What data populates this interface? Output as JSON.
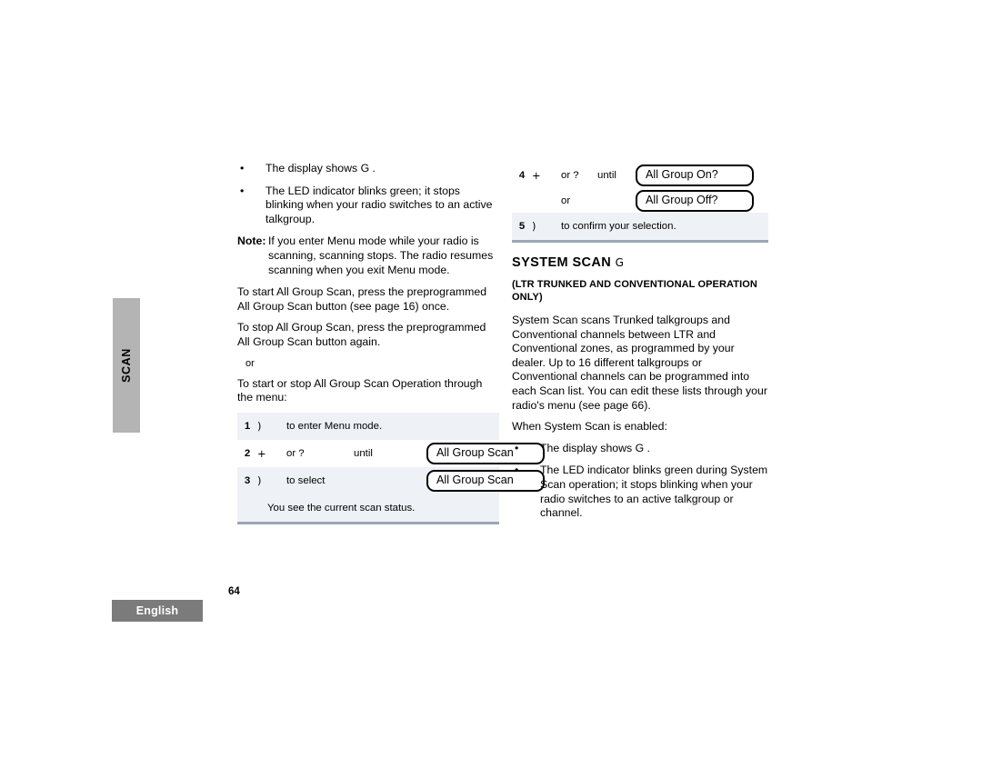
{
  "page": {
    "number": "64",
    "language_tab": "English",
    "side_tab": "SCAN"
  },
  "left_column": {
    "bullets": [
      {
        "marker": "•",
        "text": "The display shows G   ."
      },
      {
        "marker": "•",
        "text": "The LED indicator blinks green; it stops blinking when your radio switches to an active talkgroup."
      }
    ],
    "note": {
      "label": "Note:",
      "text": "If you enter Menu mode while your radio is scanning, scanning stops. The radio resumes scanning when you exit Menu mode."
    },
    "paragraphs": [
      "To start All Group Scan, press the preprogrammed All Group Scan button (see page 16) once.",
      "To stop All Group Scan, press the preprogrammed All Group Scan button again."
    ],
    "or_text": "or",
    "menu_intro": "To start or stop All Group Scan Operation through the menu:",
    "steps": [
      {
        "num": "1",
        "key": ")",
        "desc": "to enter Menu mode.",
        "lcd": ""
      },
      {
        "num": "2",
        "key": "+",
        "desc": "or ?",
        "connector": "until",
        "lcd": "All Group Scan"
      },
      {
        "num": "3",
        "key": ")",
        "desc": "to select",
        "connector": "",
        "lcd": "All Group Scan"
      }
    ],
    "status_note": "You see the current scan status."
  },
  "right_column": {
    "steps": [
      {
        "num": "4",
        "key": "+",
        "desc": "or ?",
        "connector": "until",
        "lcd": "All Group On?"
      },
      {
        "num": "",
        "key": "",
        "desc": "or",
        "connector": "",
        "lcd": "All Group Off?"
      },
      {
        "num": "5",
        "key": ")",
        "desc": "to confirm your selection.",
        "connector": "",
        "lcd": ""
      }
    ],
    "heading": "SYSTEM SCAN",
    "heading_symbol": "G",
    "subheading": "(LTR TRUNKED AND CONVENTIONAL OPERATION ONLY)",
    "body_paragraph": "System Scan scans Trunked talkgroups and Conventional channels between LTR and Conventional zones, as programmed by your dealer. Up to 16 different talkgroups or Conventional channels can be programmed into each Scan list. You can edit these lists through your radio's menu (see page 66).",
    "enabled_intro": "When System Scan is enabled:",
    "bullets": [
      {
        "marker": "•",
        "text": "The display shows G   ."
      },
      {
        "marker": "•",
        "text": "The LED indicator blinks green during System Scan operation; it stops blinking when your radio switches to an active talkgroup or channel."
      }
    ]
  },
  "colors": {
    "table_row_shade": "#eef1f5",
    "table_bottom_rule": "#9aa7b4",
    "side_tab_bg": "#b4b4b4",
    "footer_tab_bg": "#7b7b7b"
  }
}
